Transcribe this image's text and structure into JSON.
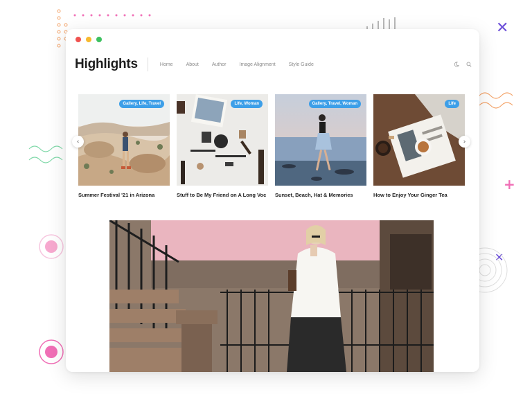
{
  "window": {
    "controls": [
      "close",
      "minimize",
      "maximize"
    ]
  },
  "header": {
    "logo": "Highlights",
    "nav": [
      "Home",
      "About",
      "Author",
      "Image Alignment",
      "Style Guide"
    ],
    "icons": [
      "moon-icon",
      "search-icon"
    ]
  },
  "carousel": {
    "cards": [
      {
        "tag": "Gallery, Life, Travel",
        "title": "Summer Festival '21 in Arizona"
      },
      {
        "tag": "Life, Woman",
        "title": "Stuff to Be My Friend on A Long Voc"
      },
      {
        "tag": "Gallery, Travel, Woman",
        "title": "Sunset, Beach, Hat & Memories"
      },
      {
        "tag": "Life",
        "title": "How to Enjoy Your Ginger Tea"
      }
    ],
    "prev": "‹",
    "next": "›"
  },
  "colors": {
    "accent": "#3d9fe8",
    "title": "#1d1d1d"
  }
}
